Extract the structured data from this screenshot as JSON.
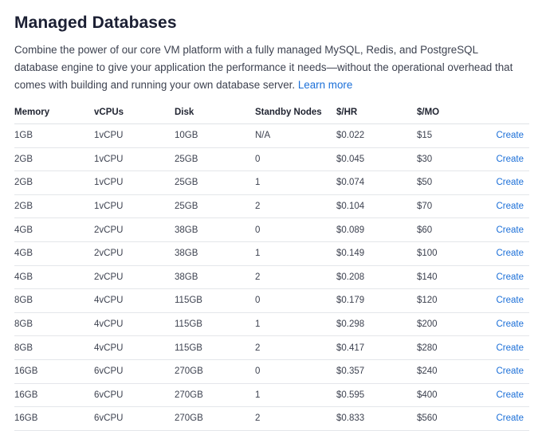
{
  "header": {
    "title": "Managed Databases",
    "description": "Combine the power of our core VM platform with a fully managed MySQL, Redis, and PostgreSQL database engine to give your application the performance it needs—without the operational overhead that comes with building and running your own database server.",
    "learn_more_label": "Learn more"
  },
  "table": {
    "columns": [
      "Memory",
      "vCPUs",
      "Disk",
      "Standby Nodes",
      "$/HR",
      "$/MO"
    ],
    "action_label": "Create",
    "rows": [
      {
        "memory": "1GB",
        "vcpus": "1vCPU",
        "disk": "10GB",
        "standby": "N/A",
        "hr": "$0.022",
        "mo": "$15"
      },
      {
        "memory": "2GB",
        "vcpus": "1vCPU",
        "disk": "25GB",
        "standby": "0",
        "hr": "$0.045",
        "mo": "$30"
      },
      {
        "memory": "2GB",
        "vcpus": "1vCPU",
        "disk": "25GB",
        "standby": "1",
        "hr": "$0.074",
        "mo": "$50"
      },
      {
        "memory": "2GB",
        "vcpus": "1vCPU",
        "disk": "25GB",
        "standby": "2",
        "hr": "$0.104",
        "mo": "$70"
      },
      {
        "memory": "4GB",
        "vcpus": "2vCPU",
        "disk": "38GB",
        "standby": "0",
        "hr": "$0.089",
        "mo": "$60"
      },
      {
        "memory": "4GB",
        "vcpus": "2vCPU",
        "disk": "38GB",
        "standby": "1",
        "hr": "$0.149",
        "mo": "$100"
      },
      {
        "memory": "4GB",
        "vcpus": "2vCPU",
        "disk": "38GB",
        "standby": "2",
        "hr": "$0.208",
        "mo": "$140"
      },
      {
        "memory": "8GB",
        "vcpus": "4vCPU",
        "disk": "115GB",
        "standby": "0",
        "hr": "$0.179",
        "mo": "$120"
      },
      {
        "memory": "8GB",
        "vcpus": "4vCPU",
        "disk": "115GB",
        "standby": "1",
        "hr": "$0.298",
        "mo": "$200"
      },
      {
        "memory": "8GB",
        "vcpus": "4vCPU",
        "disk": "115GB",
        "standby": "2",
        "hr": "$0.417",
        "mo": "$280"
      },
      {
        "memory": "16GB",
        "vcpus": "6vCPU",
        "disk": "270GB",
        "standby": "0",
        "hr": "$0.357",
        "mo": "$240"
      },
      {
        "memory": "16GB",
        "vcpus": "6vCPU",
        "disk": "270GB",
        "standby": "1",
        "hr": "$0.595",
        "mo": "$400"
      },
      {
        "memory": "16GB",
        "vcpus": "6vCPU",
        "disk": "270GB",
        "standby": "2",
        "hr": "$0.833",
        "mo": "$560"
      }
    ]
  },
  "colors": {
    "link": "#1b6fd8",
    "title": "#1b1f33",
    "text": "#3d4250",
    "divider": "#e4e6ea"
  }
}
